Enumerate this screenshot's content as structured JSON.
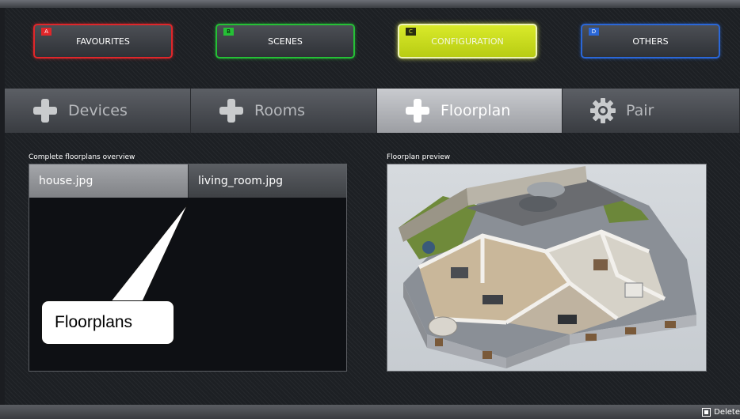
{
  "mode_buttons": [
    {
      "letter": "A",
      "label": "FAVOURITES"
    },
    {
      "letter": "B",
      "label": "SCENES"
    },
    {
      "letter": "C",
      "label": "CONFIGURATION",
      "active": true
    },
    {
      "letter": "D",
      "label": "OTHERS"
    }
  ],
  "tabs": [
    {
      "label": "Devices",
      "icon": "plus-icon"
    },
    {
      "label": "Rooms",
      "icon": "plus-icon"
    },
    {
      "label": "Floorplan",
      "icon": "plus-icon",
      "active": true
    },
    {
      "label": "Pair",
      "icon": "gear-icon"
    }
  ],
  "overview": {
    "title": "Complete floorplans overview",
    "files": [
      "house.jpg",
      "living_room.jpg"
    ],
    "selected": "house.jpg"
  },
  "preview": {
    "title": "Floorplan preview"
  },
  "callout": {
    "text": "Floorplans"
  },
  "bottom": {
    "delete_label": "Delete"
  },
  "colors": {
    "a": "#e0262a",
    "b": "#25c036",
    "c": "#d9ea2a",
    "d": "#2a67d8"
  }
}
